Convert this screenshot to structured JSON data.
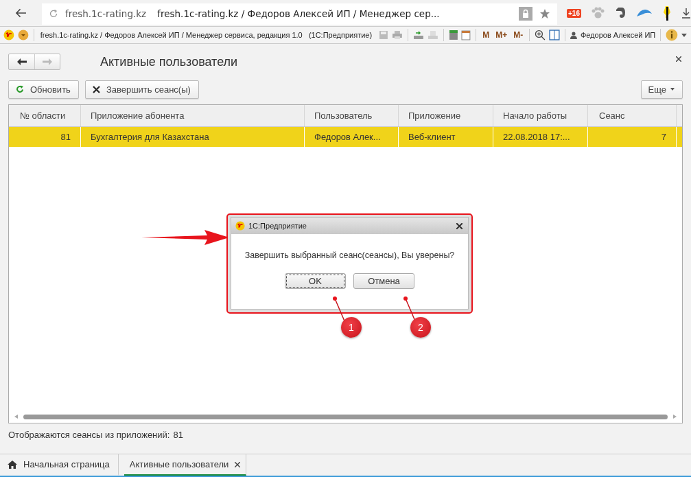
{
  "browser": {
    "host": "fresh.1c-rating.kz",
    "title": "fresh.1c-rating.kz / Федоров Алексей ИП / Менеджер сер...",
    "badge": "+16"
  },
  "app_bar": {
    "title": "fresh.1c-rating.kz / Федоров Алексей ИП / Менеджер сервиса, редакция 1.0   (1С:Предприятие)",
    "memory_buttons": [
      "M",
      "M+",
      "M-"
    ],
    "user": "Федоров Алексей ИП"
  },
  "form": {
    "title": "Активные пользователи",
    "commands": [
      {
        "kind": "refresh",
        "label": "Обновить"
      },
      {
        "kind": "close",
        "label": "Завершить сеанс(ы)"
      }
    ],
    "more": "Еще",
    "table": {
      "columns": [
        {
          "label": "№ области",
          "kind": "number"
        },
        {
          "label": "Приложение абонента",
          "kind": "text"
        },
        {
          "label": "Пользователь",
          "kind": "text"
        },
        {
          "label": "Приложение",
          "kind": "text"
        },
        {
          "label": "Начало работы",
          "kind": "text"
        },
        {
          "label": "Сеанс",
          "kind": "number"
        }
      ],
      "rows": [
        {
          "selected": true,
          "cells": [
            "81",
            "Бухгалтерия для Казахстана",
            "Федоров Алек...",
            "Веб-клиент",
            "22.08.2018 17:...",
            "7"
          ]
        }
      ]
    },
    "footer": {
      "label": "Отображаются сеансы из приложений:",
      "value": "81"
    }
  },
  "dialog": {
    "title": "1С:Предприятие",
    "message": "Завершить выбранный сеанс(сеансы), Вы уверены?",
    "buttons": [
      {
        "label": "OK",
        "default": true
      },
      {
        "label": "Отмена",
        "default": false
      }
    ],
    "callouts": [
      "1",
      "2"
    ]
  },
  "tabs": [
    {
      "kind": "home",
      "label": "Начальная страница",
      "selected": false
    },
    {
      "kind": "form",
      "label": "Активные пользователи",
      "selected": true
    }
  ]
}
